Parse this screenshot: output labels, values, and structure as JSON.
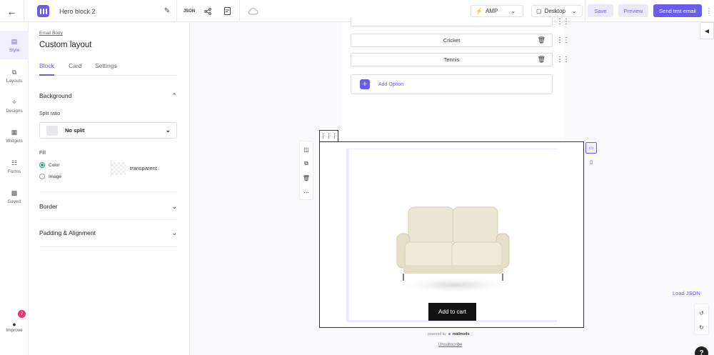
{
  "header": {
    "title": "Hero block 2",
    "json_label": "JSON",
    "amp_label": "AMP",
    "view_label": "Desktop",
    "save_label": "Save",
    "preview_label": "Preview",
    "send_label": "Send test email"
  },
  "sidebar": {
    "items": [
      {
        "label": "Style",
        "icon": "style-icon"
      },
      {
        "label": "Layouts",
        "icon": "layouts-icon"
      },
      {
        "label": "Designs",
        "icon": "designs-icon"
      },
      {
        "label": "Widgets",
        "icon": "widgets-icon"
      },
      {
        "label": "Forms",
        "icon": "forms-icon"
      },
      {
        "label": "Saved",
        "icon": "saved-icon"
      }
    ],
    "improve_label": "Improve",
    "improve_badge": "7"
  },
  "panel": {
    "breadcrumb": "Email Body",
    "title": "Custom layout",
    "tabs": [
      "Block",
      "Card",
      "Settings"
    ],
    "background_heading": "Background",
    "split_ratio_label": "Split ratio",
    "split_ratio_value": "No split",
    "fill_label": "Fill",
    "fill_options": [
      "Color",
      "Image"
    ],
    "fill_color_value": "transparent",
    "border_heading": "Border",
    "padding_heading": "Padding & Alignment"
  },
  "canvas": {
    "options": [
      "Cricket",
      "Tennis"
    ],
    "add_option_label": "Add Option",
    "cta_label": "Add to cart",
    "powered_by": "powered by",
    "brand": "mailmodo",
    "unsubscribe": "Unsubscribe",
    "load_json": "Load JSON"
  },
  "colors": {
    "accent": "#6b5ce7",
    "accent_light": "#ebe8fd",
    "cta": "#111111",
    "badge": "#e8336b"
  }
}
